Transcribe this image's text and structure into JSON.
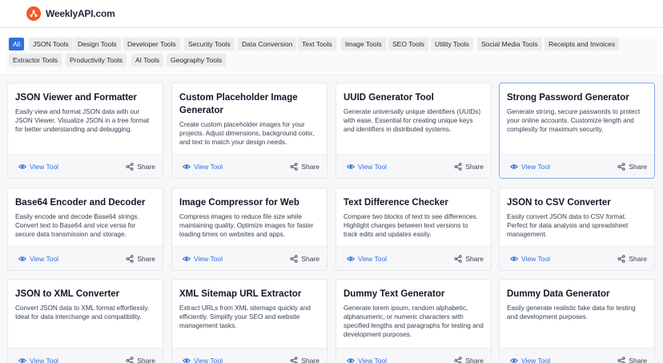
{
  "header": {
    "brand": "WeeklyAPI.com"
  },
  "filters": [
    "All",
    "JSON Tools",
    "Design Tools",
    "Developer Tools",
    "Security Tools",
    "Data Conversion",
    "Text Tools",
    "Image Tools",
    "SEO Tools",
    "Utility Tools",
    "Social Media Tools",
    "Receipts and Invoices",
    "Extractor Tools",
    "Productivity Tools",
    "AI Tools",
    "Geography Tools"
  ],
  "active_filter": "All",
  "view_label": "View Tool",
  "share_label": "Share",
  "tools": [
    {
      "title": "JSON Viewer and Formatter",
      "desc": "Easily view and format JSON data with our JSON Viewer. Visualize JSON in a tree format for better understanding and debugging."
    },
    {
      "title": "Custom Placeholder Image Generator",
      "desc": "Create custom placeholder images for your projects. Adjust dimensions, background color, and text to match your design needs."
    },
    {
      "title": "UUID Generator Tool",
      "desc": "Generate universally unique identifiers (UUIDs) with ease. Essential for creating unique keys and identifiers in distributed systems."
    },
    {
      "title": "Strong Password Generator",
      "desc": "Generate strong, secure passwords to protect your online accounts. Customize length and complexity for maximum security."
    },
    {
      "title": "Base64 Encoder and Decoder",
      "desc": "Easily encode and decode Base64 strings. Convert text to Base64 and vice versa for secure data transmission and storage."
    },
    {
      "title": "Image Compressor for Web",
      "desc": "Compress images to reduce file size while maintaining quality. Optimize images for faster loading times on websites and apps."
    },
    {
      "title": "Text Difference Checker",
      "desc": "Compare two blocks of text to see differences. Highlight changes between text versions to track edits and updates easily."
    },
    {
      "title": "JSON to CSV Converter",
      "desc": "Easily convert JSON data to CSV format. Perfect for data analysis and spreadsheet management."
    },
    {
      "title": "JSON to XML Converter",
      "desc": "Convert JSON data to XML format effortlessly. Ideal for data interchange and compatibility."
    },
    {
      "title": "XML Sitemap URL Extractor",
      "desc": "Extract URLs from XML sitemaps quickly and efficiently. Simplify your SEO and website management tasks."
    },
    {
      "title": "Dummy Text Generator",
      "desc": "Generate lorem ipsum, random alphabetic, alphanumeric, or numeric characters with specified lengths and paragraphs for testing and development purposes."
    },
    {
      "title": "Dummy Data Generator",
      "desc": "Easily generate realistic fake data for testing and development purposes."
    }
  ],
  "colors": {
    "accent": "#2f6fe4",
    "brand": "#f15a24",
    "chip": "#ececec",
    "card_footer": "#f7f7f9"
  },
  "icons": {
    "logo": "logo-icon",
    "view": "eye-icon",
    "share": "share-icon"
  }
}
